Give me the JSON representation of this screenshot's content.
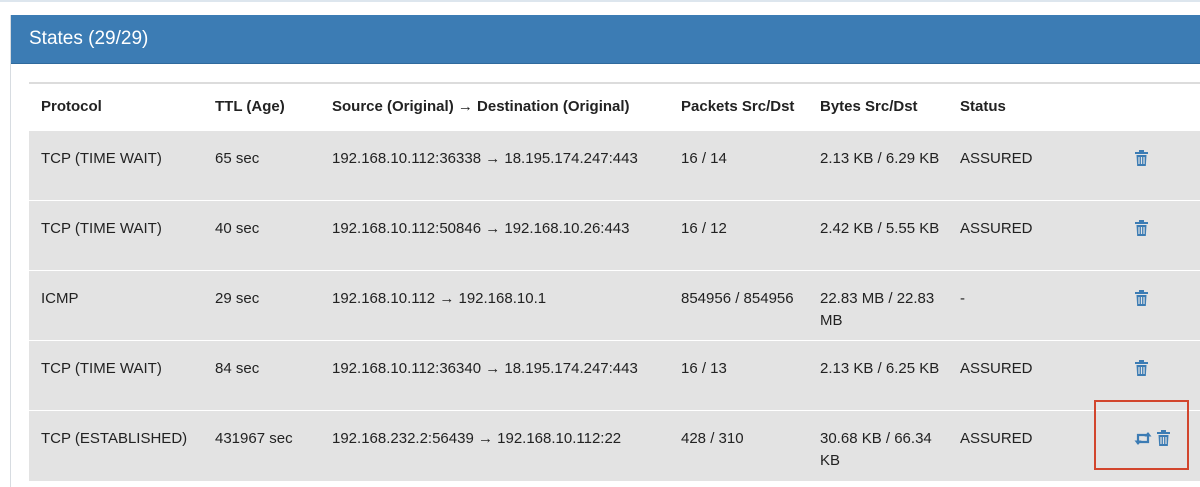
{
  "panel": {
    "title": "States (29/29)"
  },
  "table": {
    "headers": {
      "protocol": "Protocol",
      "ttl": "TTL (Age)",
      "source_dest": "Source (Original) → Destination (Original)",
      "packets": "Packets Src/Dst",
      "bytes": "Bytes Src/Dst",
      "status": "Status"
    },
    "rows": [
      {
        "protocol": "TCP (TIME WAIT)",
        "ttl": "65 sec",
        "source_dest": "192.168.10.112:36338 → 18.195.174.247:443",
        "packets": "16 / 14",
        "bytes": "2.13 KB / 6.29 KB",
        "status": "ASSURED",
        "actions": [
          "trash-icon"
        ]
      },
      {
        "protocol": "TCP (TIME WAIT)",
        "ttl": "40 sec",
        "source_dest": "192.168.10.112:50846 → 192.168.10.26:443",
        "packets": "16 / 12",
        "bytes": "2.42 KB / 5.55 KB",
        "status": "ASSURED",
        "actions": [
          "trash-icon"
        ]
      },
      {
        "protocol": "ICMP",
        "ttl": "29 sec",
        "source_dest": "192.168.10.112 → 192.168.10.1",
        "packets": "854956 / 854956",
        "bytes": "22.83 MB / 22.83 MB",
        "status": "-",
        "actions": [
          "trash-icon"
        ]
      },
      {
        "protocol": "TCP (TIME WAIT)",
        "ttl": "84 sec",
        "source_dest": "192.168.10.112:36340 → 18.195.174.247:443",
        "packets": "16 / 13",
        "bytes": "2.13 KB / 6.25 KB",
        "status": "ASSURED",
        "actions": [
          "trash-icon"
        ]
      },
      {
        "protocol": "TCP (ESTABLISHED)",
        "ttl": "431967 sec",
        "source_dest": "192.168.232.2:56439 → 192.168.10.112:22",
        "packets": "428 / 310",
        "bytes": "30.68 KB / 66.34 KB",
        "status": "ASSURED",
        "actions": [
          "retweet-icon",
          "trash-icon"
        ]
      }
    ]
  },
  "colors": {
    "panel_heading": "#3c7cb4",
    "row_shade": "#e3e3e3",
    "icon": "#3c7cb4",
    "highlight": "#d2452d"
  }
}
